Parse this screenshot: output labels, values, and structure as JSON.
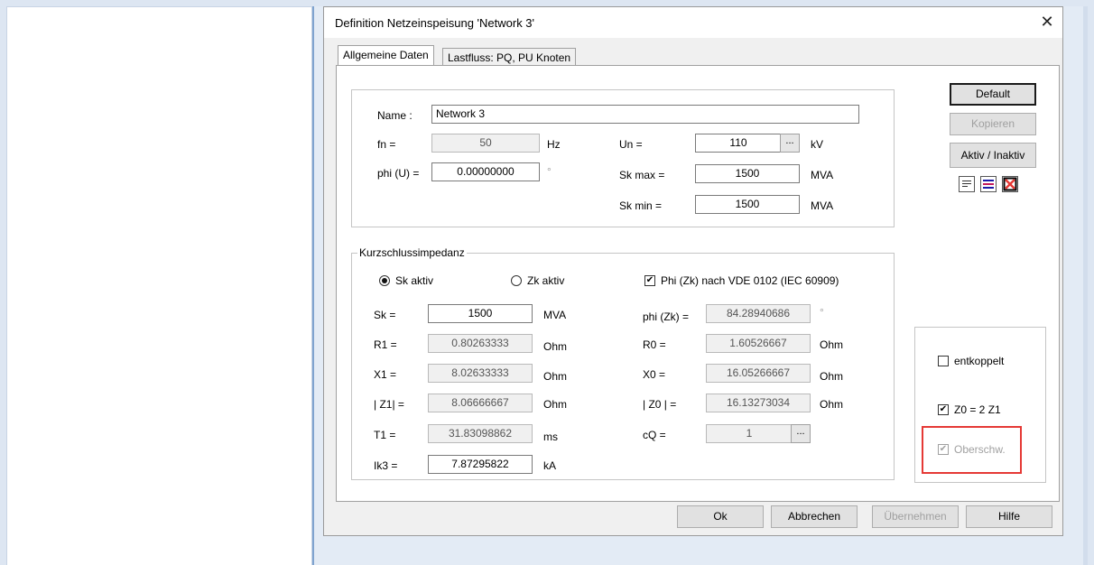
{
  "dialog": {
    "title": "Definition Netzeinspeisung 'Network 3'",
    "close_glyph": "✕",
    "tabs": [
      "Allgemeine Daten",
      "Lastfluss: PQ, PU Knoten"
    ]
  },
  "general": {
    "name_label": "Name :",
    "name_value": "Network 3",
    "fn_label": "fn =",
    "fn_value": "50",
    "fn_unit": "Hz",
    "phi_u_label": "phi (U) =",
    "phi_u_value": "0.00000000",
    "phi_u_unit": "°",
    "un_label": "Un =",
    "un_value": "110",
    "un_unit": "kV",
    "skmax_label": "Sk max =",
    "skmax_value": "1500",
    "skmax_unit": "MVA",
    "skmin_label": "Sk min =",
    "skmin_value": "1500",
    "skmin_unit": "MVA",
    "dots": "..."
  },
  "short_circuit": {
    "group_label": "Kurzschlussimpedanz",
    "sk_aktiv": "Sk aktiv",
    "zk_aktiv": "Zk aktiv",
    "phi_vde": "Phi (Zk) nach VDE 0102 (IEC 60909)",
    "sk_label": "Sk =",
    "sk_value": "1500",
    "sk_unit": "MVA",
    "r1_label": "R1 =",
    "r1_value": "0.80263333",
    "r1_unit": "Ohm",
    "x1_label": "X1 =",
    "x1_value": "8.02633333",
    "x1_unit": "Ohm",
    "z1_label": "| Z1| =",
    "z1_value": "8.06666667",
    "z1_unit": "Ohm",
    "t1_label": "T1 =",
    "t1_value": "31.83098862",
    "t1_unit": "ms",
    "ik3_label": "Ik3 =",
    "ik3_value": "7.87295822",
    "ik3_unit": "kA",
    "phizk_label": "phi (Zk) =",
    "phizk_value": "84.28940686",
    "phizk_unit": "°",
    "r0_label": "R0 =",
    "r0_value": "1.60526667",
    "r0_unit": "Ohm",
    "x0_label": "X0 =",
    "x0_value": "16.05266667",
    "x0_unit": "Ohm",
    "z0_label": "| Z0 | =",
    "z0_value": "16.13273034",
    "z0_unit": "Ohm",
    "cq_label": "cQ =",
    "cq_value": "1"
  },
  "side": {
    "default": "Default",
    "kopieren": "Kopieren",
    "aktiv_inaktiv": "Aktiv / Inaktiv",
    "entkoppelt": "entkoppelt",
    "z0_2z1": "Z0 = 2 Z1",
    "oberschw": "Oberschw."
  },
  "footer": {
    "ok": "Ok",
    "abbrechen": "Abbrechen",
    "uebernehmen": "Übernehmen",
    "hilfe": "Hilfe"
  },
  "check_glyph": "✔",
  "colors": {
    "highlight_box": "#e53935",
    "window_bg": "#f0f0f0",
    "pane_divider": "#7fa3cf"
  }
}
